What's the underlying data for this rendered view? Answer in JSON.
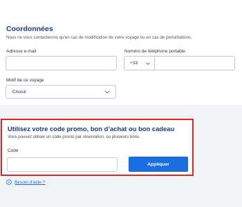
{
  "contact": {
    "title": "Coordonnées",
    "subtitle": "Nous ne vous contacterons qu'en cas de modification de votre voyage ou en cas de perturbations.",
    "email": {
      "label": "Adresse e-mail",
      "value": "",
      "placeholder": ""
    },
    "phone": {
      "label": "Numéro de téléphone portable",
      "dial_code": "+33",
      "value": "",
      "placeholder": ""
    },
    "reason": {
      "label": "Motif de ce voyage",
      "selected": "Choisir"
    }
  },
  "promo": {
    "title": "Utilisez votre code promo, bon d’achat ou bon cadeau",
    "description": "Vous pouvez utiliser un code promo par réservation, ou plusieurs bons.",
    "code_label": "Code",
    "code_value": "",
    "apply_label": "Appliquer"
  },
  "help": {
    "link_label": "Besoin d’aide ?"
  },
  "colors": {
    "accent": "#1a6ee0",
    "heading": "#1c3a8a",
    "highlight_border": "#e02424",
    "band": "#f2f3f6"
  }
}
